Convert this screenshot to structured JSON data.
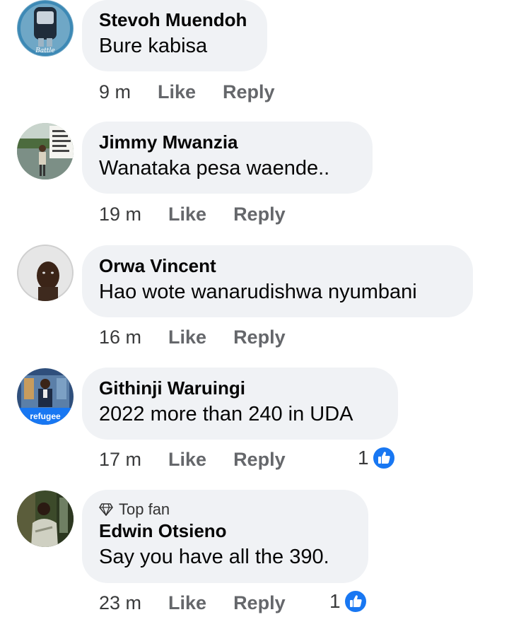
{
  "comments": [
    {
      "author": "Stevoh Muendoh",
      "text": "Bure kabisa",
      "time": "9 m",
      "like_label": "Like",
      "reply_label": "Reply",
      "avatar_caption": "Battle"
    },
    {
      "author": "Jimmy Mwanzia",
      "text": "Wanataka pesa waende..",
      "time": "19 m",
      "like_label": "Like",
      "reply_label": "Reply"
    },
    {
      "author": "Orwa Vincent",
      "text": "Hao wote wanarudishwa nyumbani",
      "time": "16 m",
      "like_label": "Like",
      "reply_label": "Reply"
    },
    {
      "author": "Githinji Waruingi",
      "text": "2022 more than 240 in UDA",
      "time": "17 m",
      "like_label": "Like",
      "reply_label": "Reply",
      "reaction_count": "1",
      "avatar_caption": "refugee"
    },
    {
      "author": "Edwin Otsieno",
      "badge": "Top fan",
      "text": "Say you have all the 390.",
      "time": "23 m",
      "like_label": "Like",
      "reply_label": "Reply",
      "reaction_count": "1"
    }
  ],
  "colors": {
    "bubble": "#f0f2f5",
    "meta": "#65676b",
    "like_blue": "#1877f2"
  }
}
